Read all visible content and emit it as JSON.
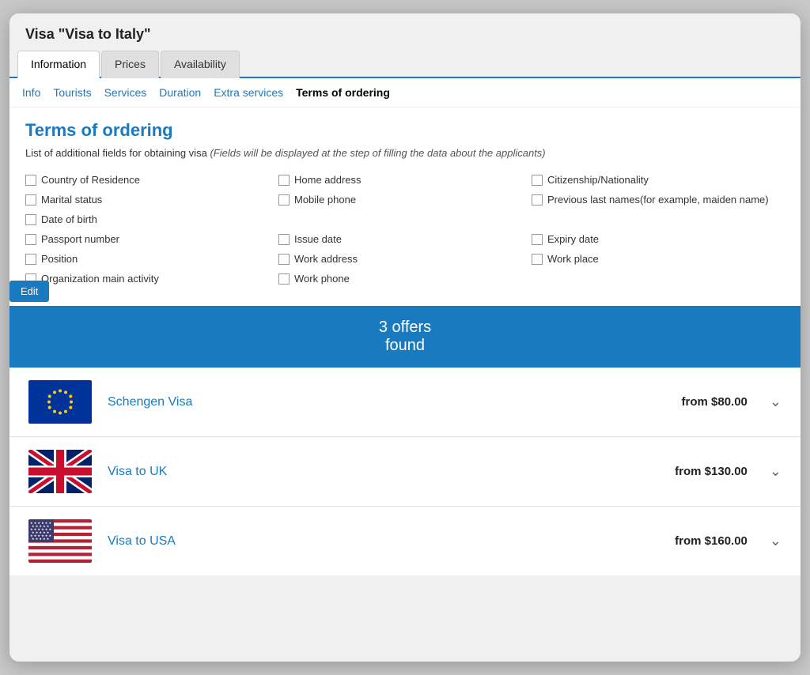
{
  "window": {
    "title": "Visa \"Visa to Italy\""
  },
  "tabs": [
    {
      "label": "Information",
      "active": true
    },
    {
      "label": "Prices",
      "active": false
    },
    {
      "label": "Availability",
      "active": false
    }
  ],
  "nav_links": [
    {
      "label": "Info",
      "active": false
    },
    {
      "label": "Tourists",
      "active": false
    },
    {
      "label": "Services",
      "active": false
    },
    {
      "label": "Duration",
      "active": false
    },
    {
      "label": "Extra services",
      "active": false
    },
    {
      "label": "Terms of ordering",
      "active": true
    }
  ],
  "section": {
    "title": "Terms of ordering",
    "description": "List of additional fields for obtaining visa",
    "description_italic": "(Fields will be displayed at the step of filling the data about the applicants)"
  },
  "fields": {
    "col1": [
      "Country of Residence",
      "Marital status",
      "",
      "Date of birth",
      "",
      "Passport number",
      "",
      "Position",
      "Organization main activity"
    ],
    "col2": [
      "Home address",
      "Mobile phone",
      "",
      "",
      "",
      "Issue date",
      "",
      "Work address",
      "Work phone"
    ],
    "col3": [
      "Citizenship/Nationality",
      "Previous last names(for example, maiden name)",
      "",
      "",
      "",
      "Expiry date",
      "",
      "Work place",
      ""
    ]
  },
  "edit_button": "Edit",
  "offers_header": "3 offers",
  "offers_subheader": "found",
  "offers": [
    {
      "name": "Schengen Visa",
      "price": "from $80.00",
      "flag": "eu"
    },
    {
      "name": "Visa to UK",
      "price": "from $130.00",
      "flag": "uk"
    },
    {
      "name": "Visa to USA",
      "price": "from $160.00",
      "flag": "us"
    }
  ]
}
